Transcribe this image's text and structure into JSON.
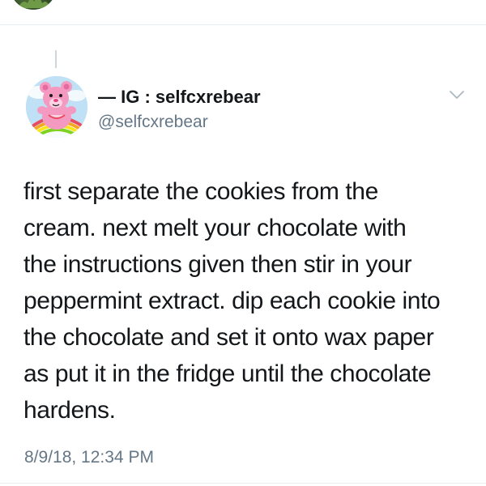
{
  "tweet": {
    "display_name": "— IG : selfcxrebear",
    "handle": "@selfcxrebear",
    "text_lines": [
      "first separate the cookies from the",
      "cream. next melt your chocolate with",
      "the instructions given then stir in your",
      "peppermint extract. dip each cookie into",
      "the chocolate and set  it onto wax paper",
      "as put it in the fridge until the chocolate",
      "hardens."
    ],
    "timestamp": "8/9/18, 12:34 PM",
    "menu_icon": "chevron-down-icon",
    "avatar_icon": "care-bear-avatar"
  },
  "colors": {
    "text": "#14171a",
    "secondary_text": "#657786",
    "divider": "#e6ecf0",
    "thread_line": "#ccd6dd",
    "chevron": "#aab8c2"
  }
}
